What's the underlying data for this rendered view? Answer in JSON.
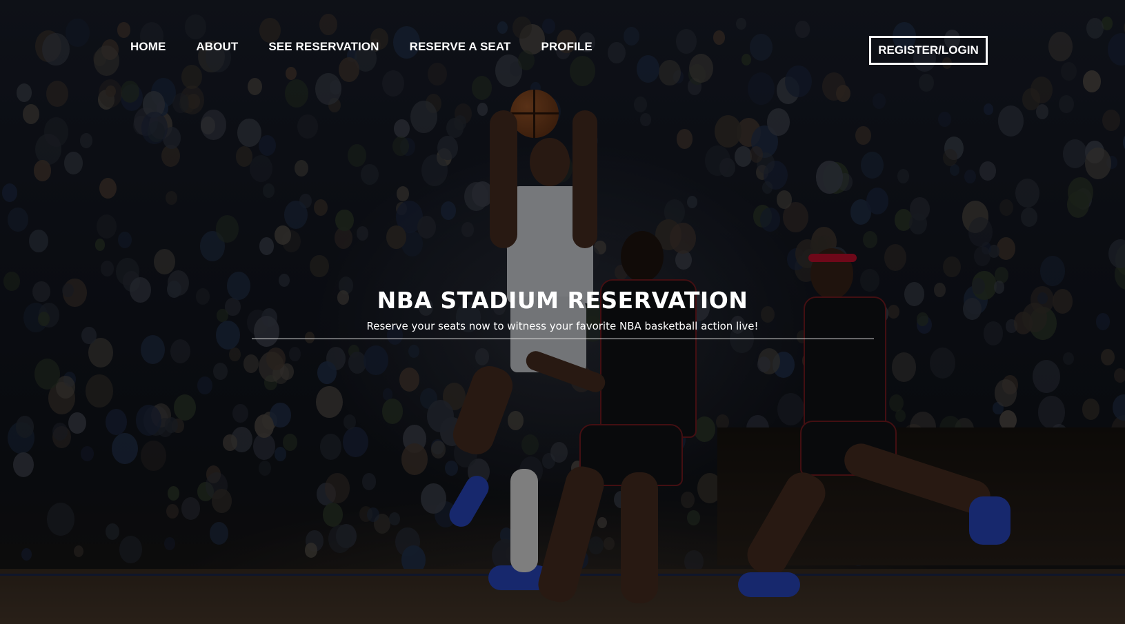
{
  "nav": {
    "links": [
      {
        "label": "HOME"
      },
      {
        "label": "ABOUT"
      },
      {
        "label": "SEE RESERVATION"
      },
      {
        "label": "RESERVE A SEAT"
      },
      {
        "label": "PROFILE"
      }
    ],
    "auth_label": "REGISTER/LOGIN"
  },
  "hero": {
    "title": "NBA STADIUM RESERVATION",
    "subtitle": "Reserve your seats now to witness your favorite NBA basketball action live!",
    "background_image": "basketball-arena-photo"
  },
  "colors": {
    "overlay": "#000000",
    "text": "#ffffff",
    "accent_red": "#c8102e"
  }
}
